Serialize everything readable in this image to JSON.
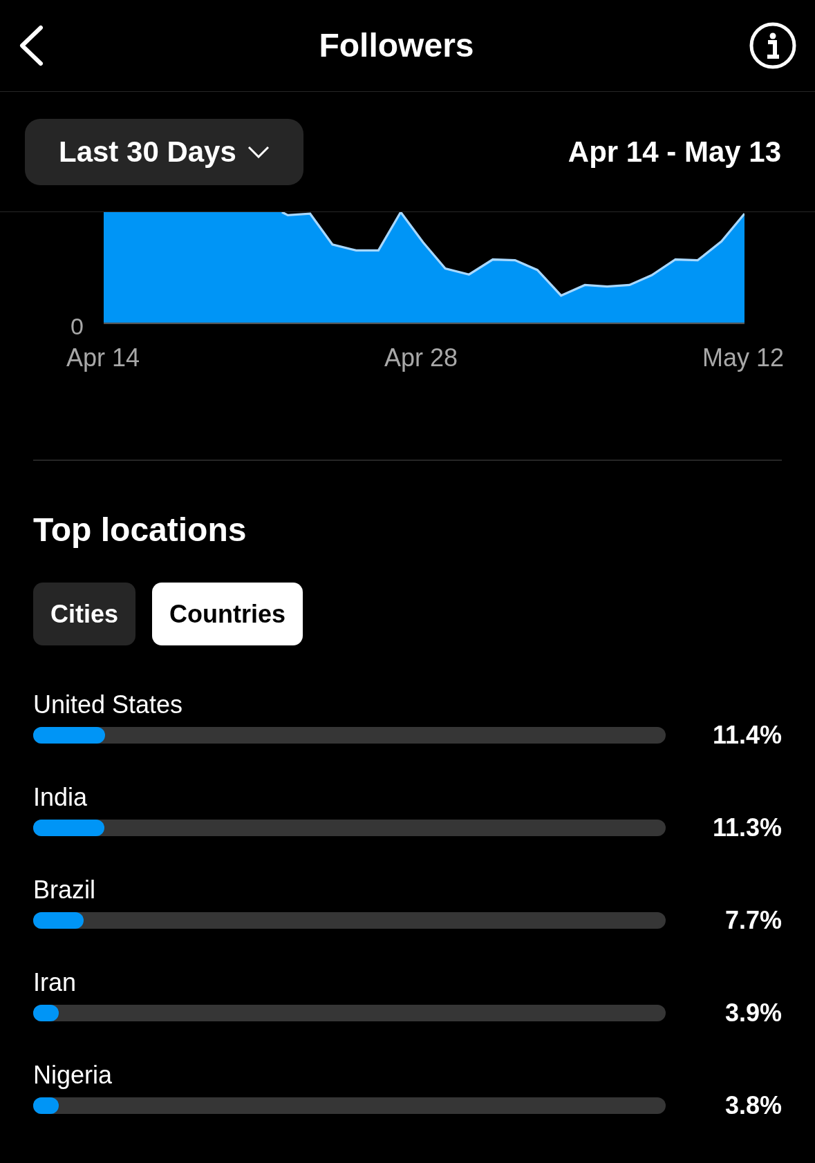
{
  "header": {
    "title": "Followers"
  },
  "range": {
    "dropdown": "Last 30 Days",
    "dates": "Apr 14 - May 13"
  },
  "chart": {
    "y_label": "0",
    "x_labels": [
      "Apr 14",
      "Apr 28",
      "May 12"
    ]
  },
  "section": {
    "title": "Top locations"
  },
  "tabs": [
    {
      "label": "Cities",
      "selected": false
    },
    {
      "label": "Countries",
      "selected": true
    }
  ],
  "locations": [
    {
      "name": "United States",
      "level": 0.114,
      "percent": "11.4%"
    },
    {
      "name": "India",
      "level": 0.113,
      "percent": "11.3%"
    },
    {
      "name": "Brazil",
      "level": 0.08,
      "percent": "7.7%"
    },
    {
      "name": "Iran",
      "level": 0.04,
      "percent": "3.9%"
    },
    {
      "name": "Nigeria",
      "level": 0.04,
      "percent": "3.8%"
    }
  ]
}
